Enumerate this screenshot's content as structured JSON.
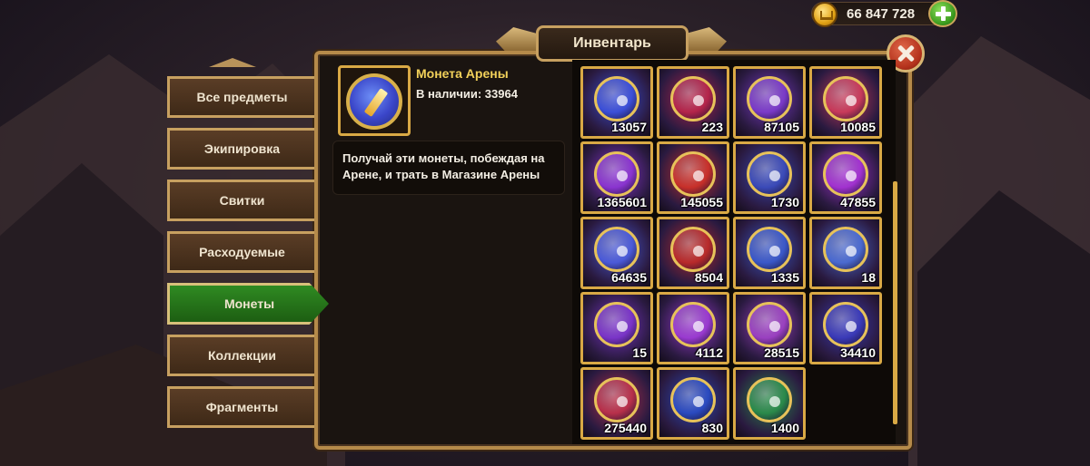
{
  "header": {
    "title": "Инвентарь",
    "gold_amount": "66 847 728",
    "gold_icon": "coin-crown-icon",
    "add_icon": "plus-icon",
    "close_icon": "close-icon"
  },
  "sidebar": {
    "tabs": [
      {
        "label": "Все предметы",
        "active": false
      },
      {
        "label": "Экипировка",
        "active": false
      },
      {
        "label": "Свитки",
        "active": false
      },
      {
        "label": "Расходуемые",
        "active": false
      },
      {
        "label": "Монеты",
        "active": true
      },
      {
        "label": "Коллекции",
        "active": false
      },
      {
        "label": "Фрагменты",
        "active": false
      }
    ]
  },
  "detail": {
    "name": "Монета Арены",
    "count_label": "В наличии: 33964",
    "description": "Получай эти монеты, побеждая на Арене, и трать в Магазине Арены",
    "icon": "arena-coin-sword-icon"
  },
  "grid": {
    "items": [
      {
        "count": "13057",
        "icon": "eye-coin-icon",
        "color": "#3b4fd8"
      },
      {
        "count": "223",
        "icon": "ruby-crown-icon",
        "color": "#b4244a"
      },
      {
        "count": "87105",
        "icon": "triangle-eye-coin-icon",
        "color": "#7a3ac8"
      },
      {
        "count": "10085",
        "icon": "tri-gem-icon",
        "color": "#c83a5a"
      },
      {
        "count": "1365601",
        "icon": "crystal-pile-icon",
        "color": "#8a34d0"
      },
      {
        "count": "145055",
        "icon": "dragon-coin-icon",
        "color": "#c8302a"
      },
      {
        "count": "1730",
        "icon": "shield-eye-coin-icon",
        "color": "#3a4ab8"
      },
      {
        "count": "47855",
        "icon": "square-hole-coin-icon",
        "color": "#a232d0"
      },
      {
        "count": "64635",
        "icon": "potion-gems-icon",
        "color": "#4a5ad8"
      },
      {
        "count": "8504",
        "icon": "guild-emblem-icon",
        "color": "#b82a2a"
      },
      {
        "count": "1335",
        "icon": "blue-flame-emblem-icon",
        "color": "#3a58c8"
      },
      {
        "count": "18",
        "icon": "cannon-icon",
        "color": "#4a6ad0"
      },
      {
        "count": "15",
        "icon": "rainbow-ring-icon",
        "color": "#7a34c8"
      },
      {
        "count": "4112",
        "icon": "winged-star-icon",
        "color": "#9a3ad0"
      },
      {
        "count": "28515",
        "icon": "gold-chest-icon",
        "color": "#9a40c0"
      },
      {
        "count": "34410",
        "icon": "gem-pile-icon",
        "color": "#3a3ab8"
      },
      {
        "count": "275440",
        "icon": "target-coin-icon",
        "color": "#b8304a"
      },
      {
        "count": "830",
        "icon": "chain-coin-icon",
        "color": "#2a4ac0"
      },
      {
        "count": "1400",
        "icon": "cards-icon",
        "color": "#2a8a4a"
      }
    ]
  }
}
